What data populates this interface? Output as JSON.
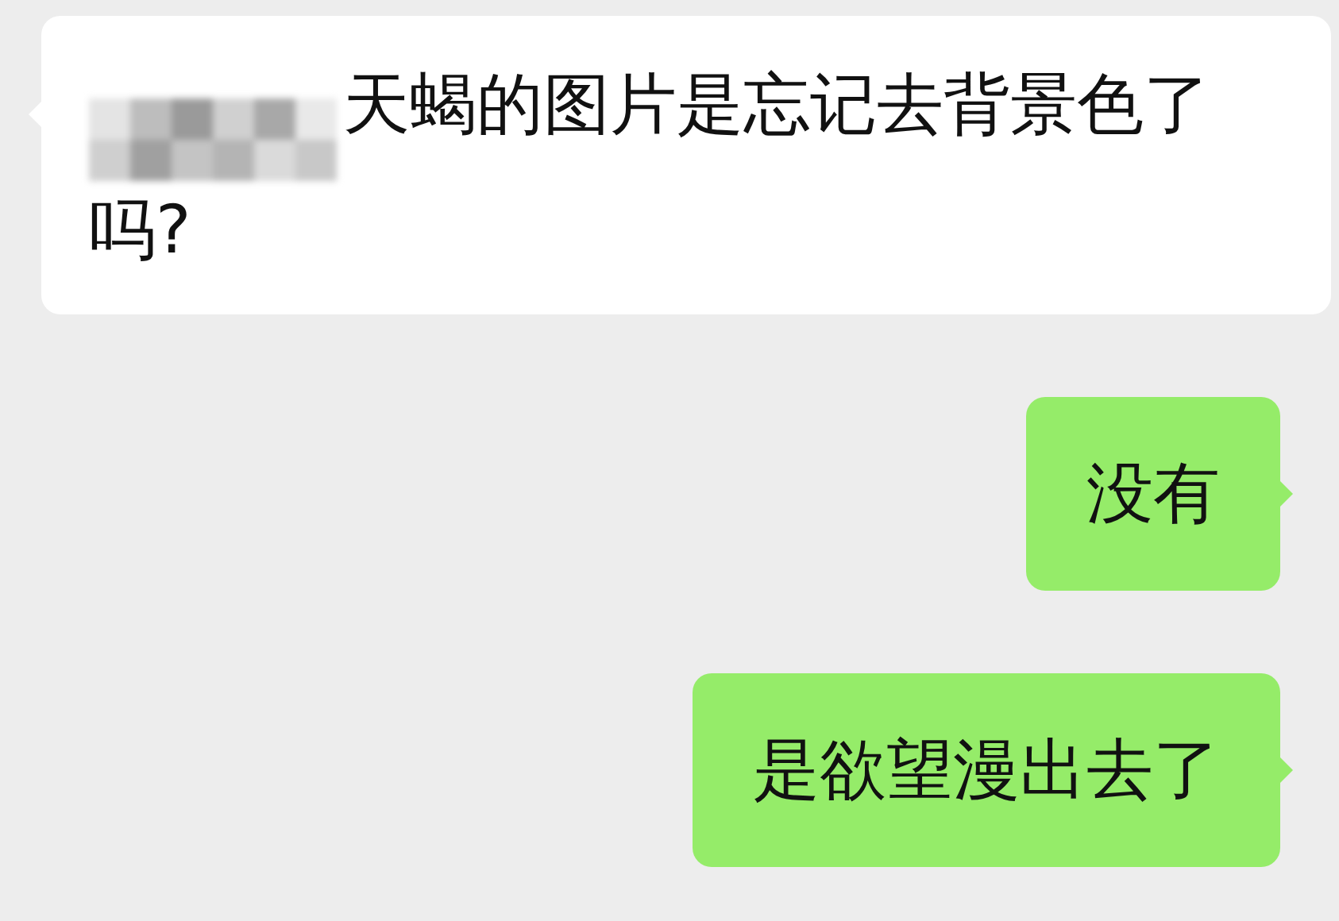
{
  "messages": [
    {
      "kind": "incoming",
      "redacted_prefix": true,
      "text": "天蝎的图片是忘记去背景色了吗?"
    },
    {
      "kind": "outgoing",
      "redacted_prefix": false,
      "text": "没有"
    },
    {
      "kind": "outgoing",
      "redacted_prefix": false,
      "text": "是欲望漫出去了"
    }
  ]
}
